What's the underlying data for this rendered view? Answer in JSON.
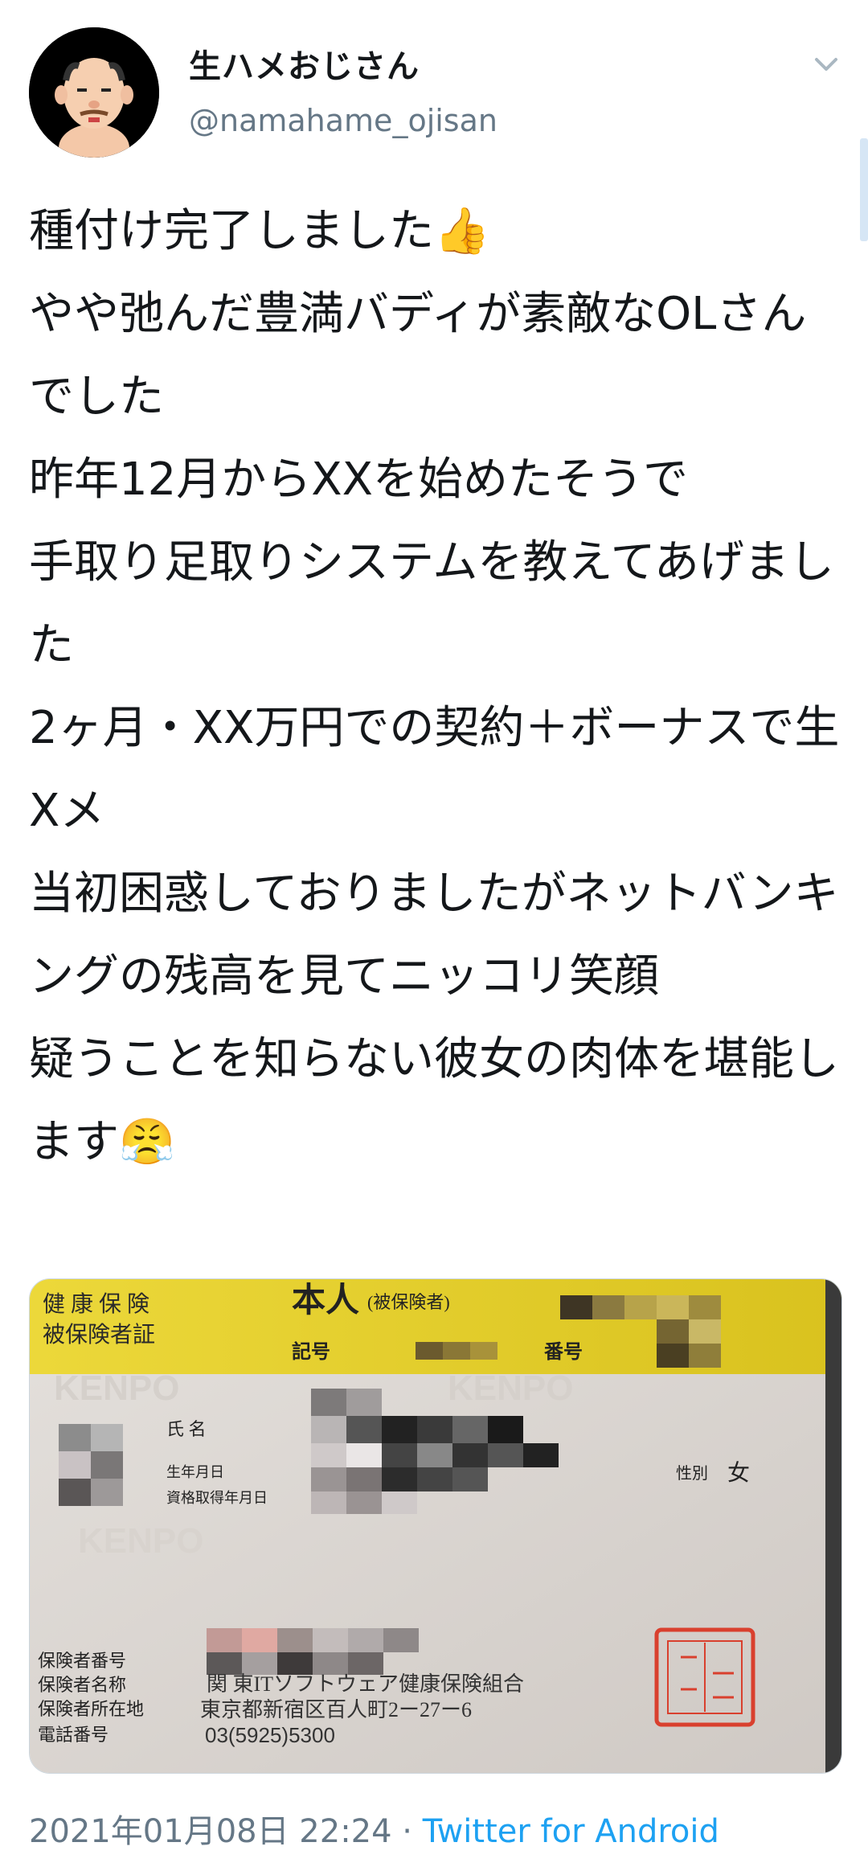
{
  "author": {
    "display_name": "生ハメおじさん",
    "handle": "@namahame_ojisan"
  },
  "tweet": {
    "text": "種付け完了しました👍\nやや弛んだ豊満バディが素敵なOLさんでした\n昨年12月からXXを始めたそうで\n手取り足取りシステムを教えてあげました\n2ヶ月・XX万円での契約＋ボーナスで生Xメ\n当初困惑しておりましたがネットバンキングの残高を見てニッコリ笑顔\n疑うことを知らない彼女の肉体を堪能します😤",
    "timestamp": "2021年01月08日 22:24",
    "separator": " · ",
    "source": "Twitter for Android"
  },
  "card": {
    "title_line1": "健 康 保 険",
    "title_line2": "被保険者証",
    "holder": "本人",
    "holder_note": "(被保険者)",
    "symbol_label": "記号",
    "number_label": "番号",
    "watermark": "KENPO",
    "name_label": "氏 名",
    "dob_label": "生年月日",
    "acquired_label": "資格取得年月日",
    "sex_label": "性別",
    "sex_value": "女",
    "insurer_number_label": "保険者番号",
    "insurer_name_label": "保険者名称",
    "insurer_name_value": "関 東ITソフトウェア健康保険組合",
    "insurer_address_label": "保険者所在地",
    "insurer_address_value": "東京都新宿区百人町2ー27ー6",
    "phone_label": "電話番号",
    "phone_value": "03(5925)5300"
  },
  "colors": {
    "card_yellow": "#e8d22a",
    "card_body": "#dedad6",
    "link": "#1da1f2",
    "secondary_text": "#657786",
    "stamp_red": "#d9402e"
  }
}
